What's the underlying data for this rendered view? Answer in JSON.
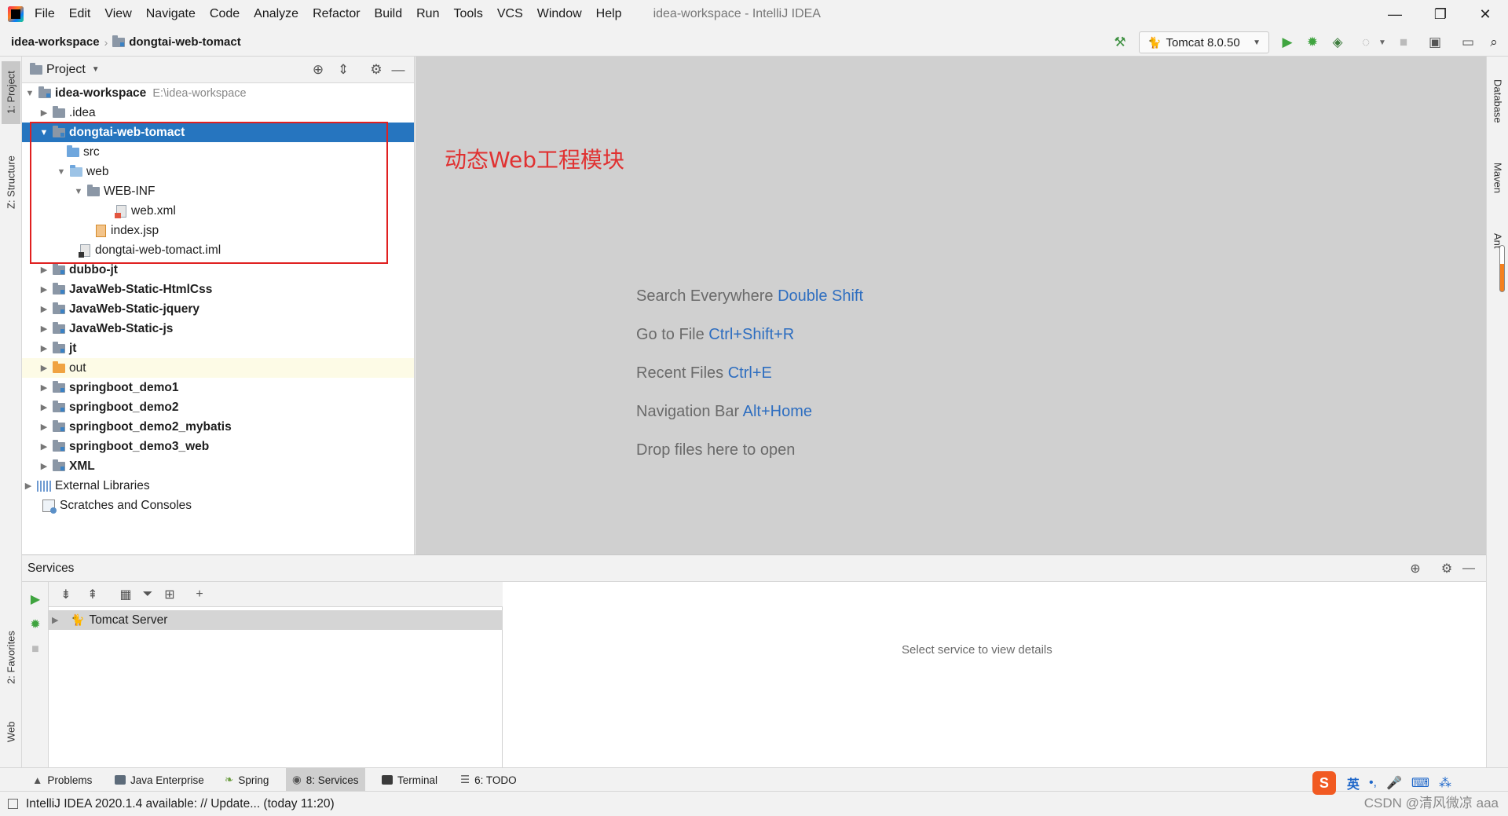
{
  "app": {
    "menu": [
      "File",
      "Edit",
      "View",
      "Navigate",
      "Code",
      "Analyze",
      "Refactor",
      "Build",
      "Run",
      "Tools",
      "VCS",
      "Window",
      "Help"
    ],
    "window_title": "idea-workspace - IntelliJ IDEA",
    "controls": {
      "minimize": "—",
      "restore": "❐",
      "close": "✕"
    }
  },
  "navbar": {
    "breadcrumb": [
      "idea-workspace",
      "dongtai-web-tomact"
    ],
    "run_config": "Tomcat 8.0.50"
  },
  "left_strip": {
    "project_tab": "1: Project",
    "structure_tab": "Z: Structure",
    "favorites_tab": "2: Favorites",
    "web_tab": "Web"
  },
  "right_strip": {
    "database_tab": "Database",
    "maven_tab": "Maven",
    "ant_tab": "Ant"
  },
  "project_panel": {
    "title": "Project",
    "tree": [
      {
        "label": "idea-workspace",
        "hint": "E:\\idea-workspace",
        "bold": true,
        "arrow": "▼",
        "icon": "module-folder"
      },
      {
        "label": ".idea",
        "arrow": "▶",
        "icon": "folder"
      },
      {
        "label": "dongtai-web-tomact",
        "bold": true,
        "arrow": "▼",
        "icon": "module-folder",
        "selected": true
      },
      {
        "label": "src",
        "icon": "source-folder"
      },
      {
        "label": "web",
        "arrow": "▼",
        "icon": "web-folder"
      },
      {
        "label": "WEB-INF",
        "arrow": "▼",
        "icon": "folder"
      },
      {
        "label": "web.xml",
        "icon": "xml-file"
      },
      {
        "label": "index.jsp",
        "icon": "jsp-file"
      },
      {
        "label": "dongtai-web-tomact.iml",
        "icon": "iml-file"
      },
      {
        "label": "dubbo-jt",
        "bold": true,
        "arrow": "▶",
        "icon": "module-folder"
      },
      {
        "label": "JavaWeb-Static-HtmlCss",
        "bold": true,
        "arrow": "▶",
        "icon": "module-folder"
      },
      {
        "label": "JavaWeb-Static-jquery",
        "bold": true,
        "arrow": "▶",
        "icon": "module-folder"
      },
      {
        "label": "JavaWeb-Static-js",
        "bold": true,
        "arrow": "▶",
        "icon": "module-folder"
      },
      {
        "label": "jt",
        "bold": true,
        "arrow": "▶",
        "icon": "module-folder"
      },
      {
        "label": "out",
        "arrow": "▶",
        "icon": "excluded-folder"
      },
      {
        "label": "springboot_demo1",
        "bold": true,
        "arrow": "▶",
        "icon": "module-folder"
      },
      {
        "label": "springboot_demo2",
        "bold": true,
        "arrow": "▶",
        "icon": "module-folder"
      },
      {
        "label": "springboot_demo2_mybatis",
        "bold": true,
        "arrow": "▶",
        "icon": "module-folder"
      },
      {
        "label": "springboot_demo3_web",
        "bold": true,
        "arrow": "▶",
        "icon": "module-folder"
      },
      {
        "label": "XML",
        "bold": true,
        "arrow": "▶",
        "icon": "module-folder"
      },
      {
        "label": "External Libraries",
        "arrow": "▶",
        "icon": "library"
      },
      {
        "label": "Scratches and Consoles",
        "icon": "scratch"
      }
    ]
  },
  "editor": {
    "annotation": "动态Web工程模块",
    "hints": [
      {
        "text": "Search Everywhere",
        "key": "Double Shift"
      },
      {
        "text": "Go to File",
        "key": "Ctrl+Shift+R"
      },
      {
        "text": "Recent Files",
        "key": "Ctrl+E"
      },
      {
        "text": "Navigation Bar",
        "key": "Alt+Home"
      },
      {
        "text": "Drop files here to open",
        "key": ""
      }
    ]
  },
  "services": {
    "title": "Services",
    "server": "Tomcat Server",
    "details_placeholder": "Select service to view details"
  },
  "bottom_tabs": [
    {
      "label": "Problems"
    },
    {
      "label": "Java Enterprise"
    },
    {
      "label": "Spring"
    },
    {
      "label": "8: Services",
      "active": true
    },
    {
      "label": "Terminal"
    },
    {
      "label": "6: TODO"
    }
  ],
  "status": {
    "message": "IntelliJ IDEA 2020.1.4 available: // Update... (today 11:20)",
    "watermark": "CSDN @清风微凉 aaa",
    "ime_label": "英"
  }
}
